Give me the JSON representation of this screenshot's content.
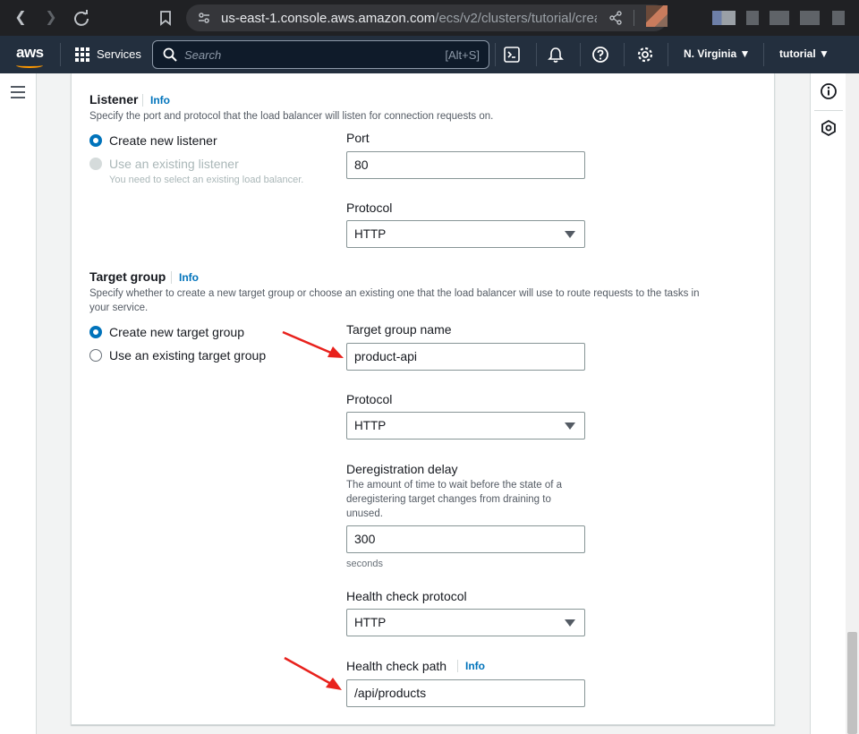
{
  "browser": {
    "url_host": "us-east-1.console.aws.amazon.com",
    "url_path": "/ecs/v2/clusters/tutorial/creat..."
  },
  "topnav": {
    "logo": "aws",
    "services": "Services",
    "search_placeholder": "Search",
    "search_shortcut": "[Alt+S]",
    "region": "N. Virginia ▼",
    "account": "tutorial ▼"
  },
  "listener": {
    "title": "Listener",
    "info": "Info",
    "description": "Specify the port and protocol that the load balancer will listen for connection requests on.",
    "option_new": "Create new listener",
    "option_existing": "Use an existing listener",
    "option_existing_hint": "You need to select an existing load balancer.",
    "port_label": "Port",
    "port_value": "80",
    "protocol_label": "Protocol",
    "protocol_value": "HTTP"
  },
  "target_group": {
    "title": "Target group",
    "info": "Info",
    "description_line1": "Specify whether to create a new target group or choose an existing one that the load balancer will use to route requests to the tasks in",
    "description_line2": "your service.",
    "option_new": "Create new target group",
    "option_existing": "Use an existing target group",
    "name_label": "Target group name",
    "name_value": "product-api",
    "protocol_label": "Protocol",
    "protocol_value": "HTTP",
    "dereg_label": "Deregistration delay",
    "dereg_desc_line1": "The amount of time to wait before the state of a",
    "dereg_desc_line2": "deregistering target changes from draining to",
    "dereg_desc_line3": "unused.",
    "dereg_value": "300",
    "dereg_unit": "seconds",
    "hc_protocol_label": "Health check protocol",
    "hc_protocol_value": "HTTP",
    "hc_path_label": "Health check path",
    "hc_path_info": "Info",
    "hc_path_value": "/api/products"
  },
  "colors": {
    "accent": "#0073bb",
    "nav_bg": "#232f3e",
    "annotation_arrow": "#e8211c"
  }
}
